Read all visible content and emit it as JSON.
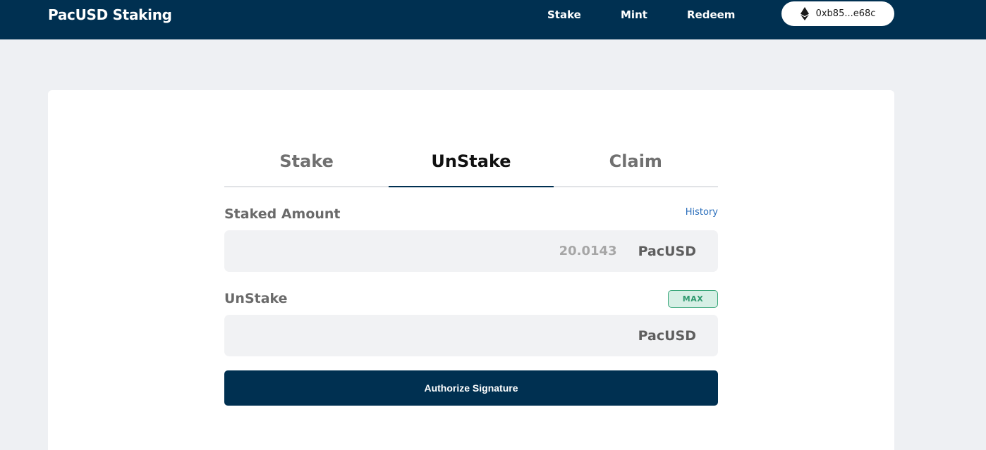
{
  "header": {
    "brand": "PacUSD Staking",
    "nav": [
      "Stake",
      "Mint",
      "Redeem"
    ],
    "wallet": {
      "icon": "ethereum-icon",
      "address": "0xb85...e68c"
    }
  },
  "tabs": {
    "items": [
      "Stake",
      "UnStake",
      "Claim"
    ],
    "active": "UnStake"
  },
  "staked": {
    "label": "Staked Amount",
    "history_link": "History",
    "value": "20.0143",
    "unit": "PacUSD"
  },
  "unstake": {
    "label": "UnStake",
    "max_label": "MAX",
    "input_value": "",
    "unit": "PacUSD"
  },
  "action": {
    "button_label": "Authorize Signature"
  },
  "colors": {
    "primary": "#003051",
    "background": "#eef0f3",
    "max_accent": "#3aa77b",
    "link": "#2a6ebb"
  }
}
